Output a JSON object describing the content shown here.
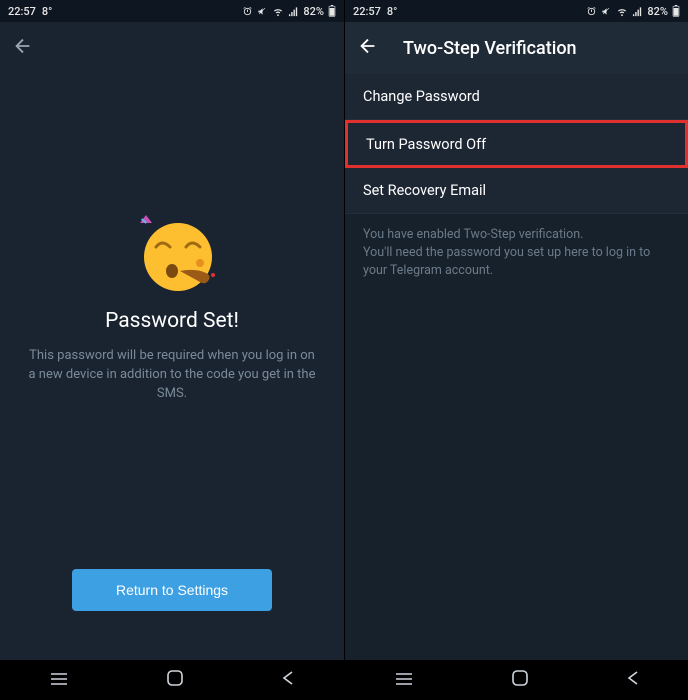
{
  "statusbar": {
    "time": "22:57",
    "temp": "8°",
    "battery": "82%"
  },
  "left": {
    "title": "Password Set!",
    "desc": "This password will be required when you log in on a new device in addition to the code you get in the SMS.",
    "button": "Return to Settings"
  },
  "right": {
    "header": "Two-Step Verification",
    "items": [
      "Change Password",
      "Turn Password Off",
      "Set Recovery Email"
    ],
    "info": "You have enabled Two-Step verification.\nYou'll need the password you set up here to log in to your Telegram account."
  }
}
